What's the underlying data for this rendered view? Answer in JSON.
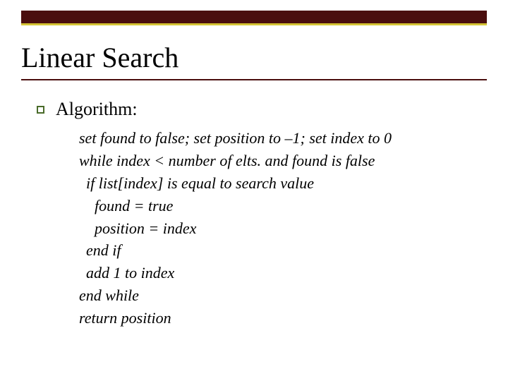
{
  "title": "Linear Search",
  "bullet": {
    "label": "Algorithm:"
  },
  "pseudocode": {
    "l1": "set found to false; set position to –1; set index to 0",
    "l2": "while index < number of elts. and found is false",
    "l3": "if list[index] is equal to search value",
    "l4": "found = true",
    "l5": "position = index",
    "l6": "end if",
    "l7": "add 1 to index",
    "l8": "end while",
    "l9": "return position"
  }
}
